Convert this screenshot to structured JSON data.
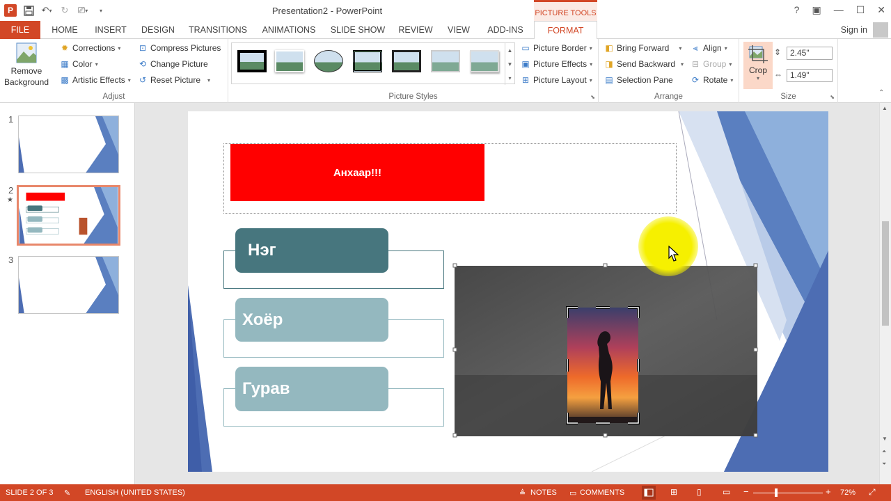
{
  "window": {
    "doc_title": "Presentation2 - PowerPoint",
    "context_tab": "PICTURE TOOLS",
    "controls": [
      "?",
      "▣",
      "—",
      "☐",
      "✕"
    ]
  },
  "tabs": [
    "FILE",
    "HOME",
    "INSERT",
    "DESIGN",
    "TRANSITIONS",
    "ANIMATIONS",
    "SLIDE SHOW",
    "REVIEW",
    "VIEW",
    "ADD-INS",
    "FORMAT"
  ],
  "active_tab": "FORMAT",
  "signin": "Sign in",
  "ribbon": {
    "adjust": {
      "label": "Adjust",
      "remove_bg_line1": "Remove",
      "remove_bg_line2": "Background",
      "corrections": "Corrections",
      "color": "Color",
      "artistic": "Artistic Effects",
      "compress": "Compress Pictures",
      "change": "Change Picture",
      "reset": "Reset Picture"
    },
    "styles": {
      "label": "Picture Styles",
      "border": "Picture Border",
      "effects": "Picture Effects",
      "layout": "Picture Layout"
    },
    "arrange": {
      "label": "Arrange",
      "bring_forward": "Bring Forward",
      "send_backward": "Send Backward",
      "selection_pane": "Selection Pane",
      "align": "Align",
      "group": "Group",
      "rotate": "Rotate"
    },
    "size": {
      "label": "Size",
      "crop": "Crop",
      "height": "2.45\"",
      "width": "1.49\""
    }
  },
  "slides": [
    {
      "num": "1"
    },
    {
      "num": "2",
      "star": "★",
      "mini_title": "Анхаар!!!"
    },
    {
      "num": "3"
    }
  ],
  "slide": {
    "banner_text": "Анхаар!!!",
    "items": [
      "Нэг",
      "Хоёр",
      "Гурав"
    ]
  },
  "colors": {
    "accent": "#d24726",
    "banner": "#ff0000",
    "item_dark": "#47767e",
    "item_light": "#94b8bf"
  },
  "status": {
    "slide_info": "SLIDE 2 OF 3",
    "language": "ENGLISH (UNITED STATES)",
    "notes": "NOTES",
    "comments": "COMMENTS",
    "zoom": "72%"
  }
}
